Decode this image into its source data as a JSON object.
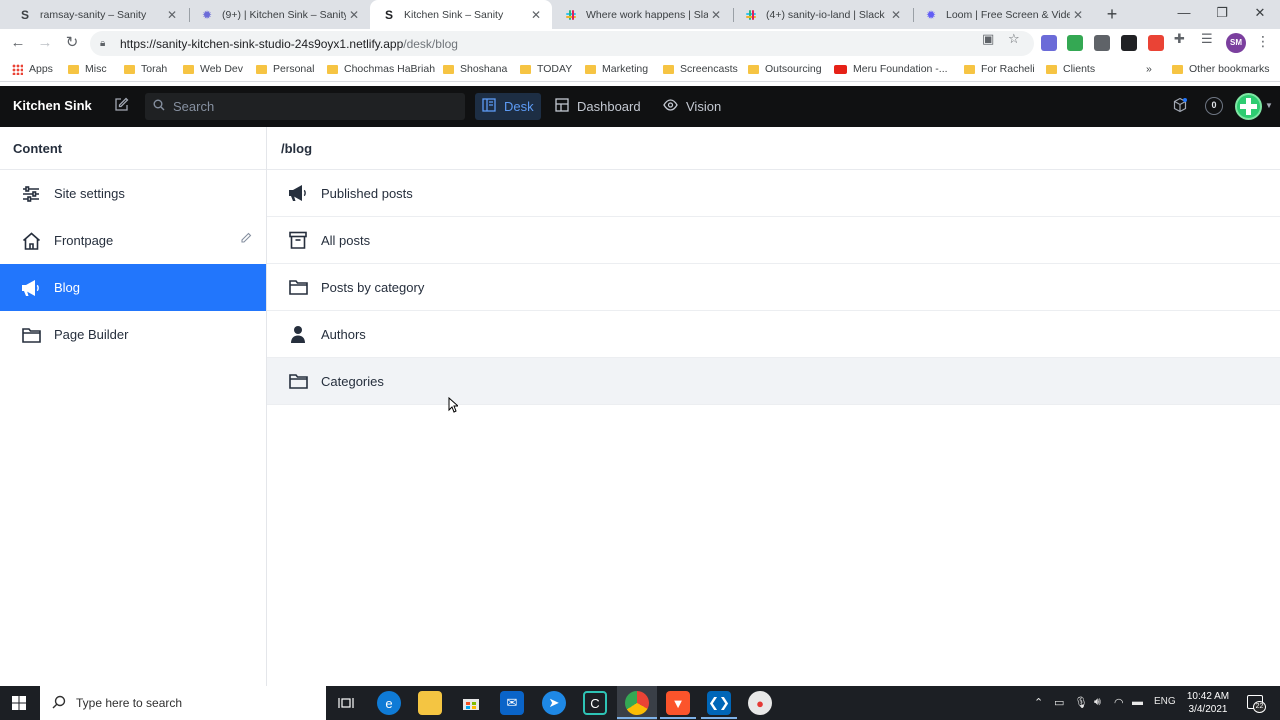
{
  "browser": {
    "tabs": [
      {
        "title": "ramsay-sanity – Sanity",
        "favicon": "sanity-s-icon",
        "active": false
      },
      {
        "title": "(9+) | Kitchen Sink – Sanity",
        "favicon": "gear-favicon-icon",
        "active": false
      },
      {
        "title": "Kitchen Sink – Sanity",
        "favicon": "sanity-s-icon",
        "active": true
      },
      {
        "title": "Where work happens | Slack",
        "favicon": "slack-icon",
        "active": false
      },
      {
        "title": "(4+) sanity-io-land | Slack",
        "favicon": "slack-icon",
        "active": false
      },
      {
        "title": "Loom | Free Screen & Video",
        "favicon": "loom-icon",
        "active": false
      }
    ],
    "url_host": "https://sanity-kitchen-sink-studio-24s9oyx1.netlify.app",
    "url_path": "/desk/blog",
    "profile_initials": "SM",
    "bookmarks": [
      "Apps",
      "Misc",
      "Torah",
      "Web Dev",
      "Personal",
      "Chochmas HaBriah",
      "Shoshana",
      "TODAY",
      "Marketing",
      "Screencasts",
      "Outsourcing",
      "Meru Foundation -...",
      "For Racheli",
      "Clients"
    ],
    "more_bookmarks": "»",
    "other_bookmarks": "Other bookmarks"
  },
  "studio": {
    "brand": "Kitchen Sink",
    "search_placeholder": "Search",
    "tools": [
      {
        "label": "Desk",
        "icon": "desk-icon",
        "selected": true
      },
      {
        "label": "Dashboard",
        "icon": "dashboard-icon",
        "selected": false
      },
      {
        "label": "Vision",
        "icon": "eye-icon",
        "selected": false
      }
    ],
    "notification_count": "0",
    "accent": "#2276fc"
  },
  "content_pane": {
    "title": "Content",
    "items": [
      {
        "label": "Site settings",
        "icon": "sliders-icon",
        "selected": false
      },
      {
        "label": "Frontpage",
        "icon": "home-icon",
        "selected": false,
        "editable": true
      },
      {
        "label": "Blog",
        "icon": "megaphone-icon",
        "selected": true
      },
      {
        "label": "Page Builder",
        "icon": "folder-icon",
        "selected": false
      }
    ]
  },
  "blog_pane": {
    "title": "/blog",
    "items": [
      {
        "label": "Published posts",
        "icon": "megaphone-icon"
      },
      {
        "label": "All posts",
        "icon": "archive-icon"
      },
      {
        "label": "Posts by category",
        "icon": "folder-icon"
      },
      {
        "label": "Authors",
        "icon": "user-icon"
      },
      {
        "label": "Categories",
        "icon": "folder-icon",
        "hovered": true
      }
    ]
  },
  "taskbar": {
    "search_placeholder": "Type here to search",
    "language": "ENG",
    "time": "10:42 AM",
    "date": "3/4/2021",
    "notifications": "22"
  }
}
